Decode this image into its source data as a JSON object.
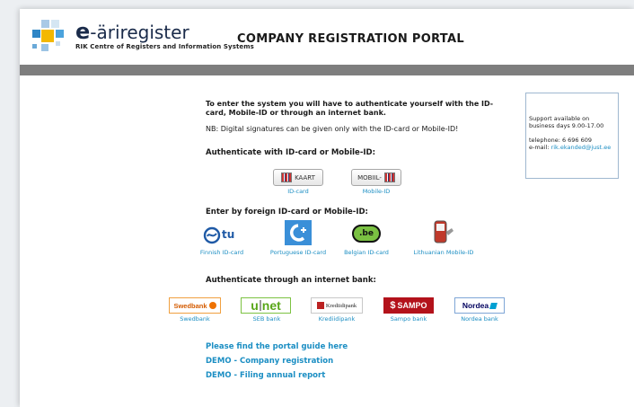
{
  "header": {
    "logo_e": "e",
    "logo_name": "-äriregister",
    "logo_subtitle": "RIK Centre of Registers and Information Systems",
    "portal_title": "COMPANY REGISTRATION PORTAL"
  },
  "intro": {
    "main": "To enter the system you will have to authenticate yourself with the ID-card, Mobile-ID or through an internet bank.",
    "nb": "NB: Digital signatures can be given only with the ID-card or Mobile-ID!"
  },
  "support": {
    "line1": "Support available on",
    "line2": "business days 9.00-17.00",
    "phone": "telephone: 6 696 609",
    "email_label": "e-mail: ",
    "email": "rik.ekanded@just.ee"
  },
  "sections": {
    "idcard": "Authenticate with ID-card or Mobile-ID:",
    "foreign": "Enter by foreign ID-card or Mobile-ID:",
    "bank": "Authenticate through an internet bank:"
  },
  "auth": {
    "idcard_btn": "KAART",
    "idcard_caption": "ID-card",
    "mobile_btn": "MOBIIL-",
    "mobile_caption": "Mobile-ID"
  },
  "foreign": {
    "finnish_logo": "tu",
    "finnish": "Finnish ID-card",
    "portuguese": "Portuguese ID-card",
    "belgian_logo": ".be",
    "belgian": "Belgian ID-card",
    "lithuanian": "Lithuanian Mobile-ID"
  },
  "banks": {
    "swedbank_logo": "Swedbank",
    "swedbank": "Swedbank",
    "seb_logo_u": "u",
    "seb_logo_net": "net",
    "seb": "SEB bank",
    "krediidipank_logo": "Krediidipank",
    "krediidipank": "Krediidipank",
    "sampo_logo": "SAMPO",
    "sampo": "Sampo bank",
    "nordea_logo": "Nordea",
    "nordea": "Nordea bank"
  },
  "links": {
    "guide": "Please find the portal guide here",
    "demo_company": "DEMO - Company registration",
    "demo_filing": "DEMO - Filing annual report"
  },
  "colors": {
    "link": "#1b8ec3",
    "bar": "#7e7e7e",
    "brand_navy": "#1a2b4a"
  }
}
